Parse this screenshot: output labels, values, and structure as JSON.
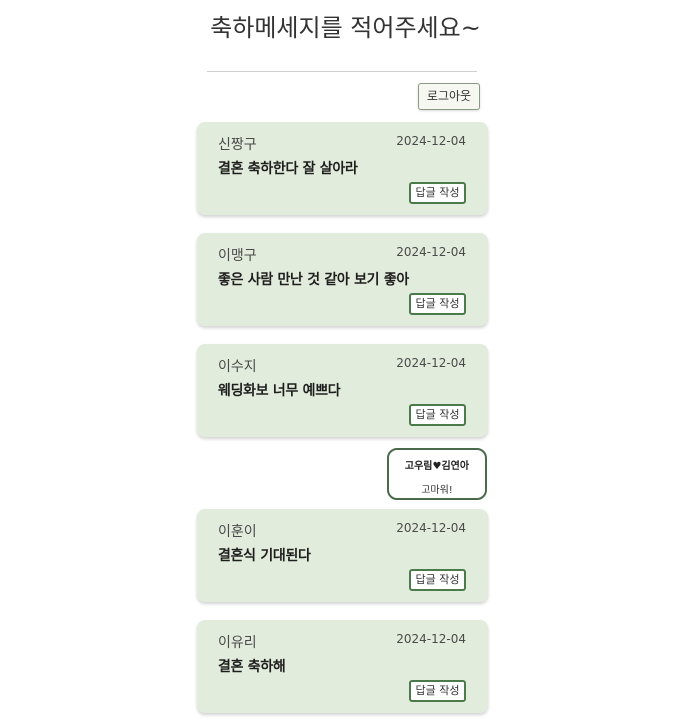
{
  "header": {
    "title": "축하메세지를 적어주세요~"
  },
  "toolbar": {
    "logout_label": "로그아웃"
  },
  "messages": [
    {
      "author": "신짱구",
      "date": "2024-12-04",
      "text": "결혼 축하한다 잘 살아라",
      "reply_label": "답글 작성"
    },
    {
      "author": "이맹구",
      "date": "2024-12-04",
      "text": "좋은 사람 만난 것 같아 보기 좋아",
      "reply_label": "답글 작성"
    },
    {
      "author": "이수지",
      "date": "2024-12-04",
      "text": "웨딩화보 너무 예쁘다",
      "reply_label": "답글 작성"
    },
    {
      "author": "이훈이",
      "date": "2024-12-04",
      "text": "결혼식 기대된다",
      "reply_label": "답글 작성"
    },
    {
      "author": "이유리",
      "date": "2024-12-04",
      "text": "결혼 축하해",
      "reply_label": "답글 작성"
    }
  ],
  "reply": {
    "author": "고우림♥김연아",
    "text": "고마워!"
  },
  "colors": {
    "card_background": "#e2ecdc",
    "button_border": "#4b7a4b",
    "reply_border": "#4b6a4b"
  }
}
